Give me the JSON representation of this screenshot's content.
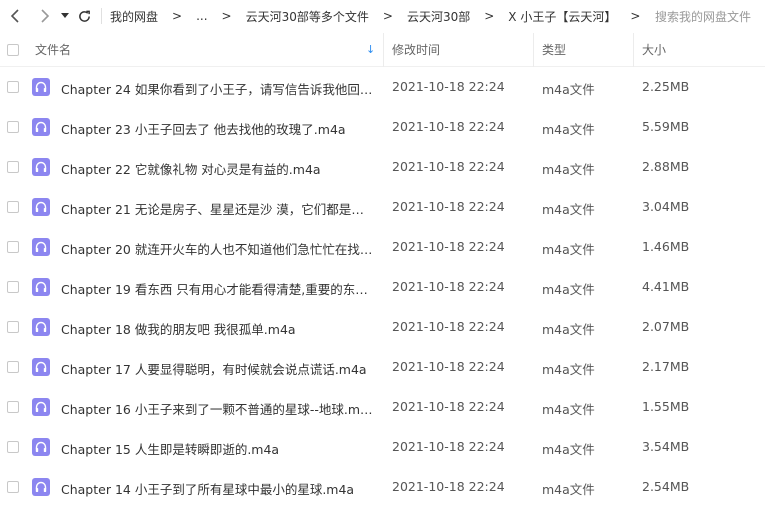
{
  "toolbar": {
    "breadcrumbs": [
      "我的网盘",
      "...",
      "云天河30部等多个文件",
      "云天河30部",
      "X 小王子【云天河】"
    ],
    "search_placeholder": "搜索我的网盘文件"
  },
  "columns": {
    "name": "文件名",
    "time": "修改时间",
    "type": "类型",
    "size": "大小"
  },
  "files": [
    {
      "name": "Chapter 24 如果你看到了小王子，请写信告诉我他回来...",
      "time": "2021-10-18 22:24",
      "type": "m4a文件",
      "size": "2.25MB"
    },
    {
      "name": "Chapter 23 小王子回去了 他去找他的玫瑰了.m4a",
      "time": "2021-10-18 22:24",
      "type": "m4a文件",
      "size": "5.59MB"
    },
    {
      "name": "Chapter 22 它就像礼物 对心灵是有益的.m4a",
      "time": "2021-10-18 22:24",
      "type": "m4a文件",
      "size": "2.88MB"
    },
    {
      "name": "Chapter 21 无论是房子、星星还是沙 漠，它们都是因为...",
      "time": "2021-10-18 22:24",
      "type": "m4a文件",
      "size": "3.04MB"
    },
    {
      "name": "Chapter 20 就连开火车的人也不知道他们急忙忙在找什...",
      "time": "2021-10-18 22:24",
      "type": "m4a文件",
      "size": "1.46MB"
    },
    {
      "name": "Chapter 19 看东西 只有用心才能看得清楚,重要的东西用...",
      "time": "2021-10-18 22:24",
      "type": "m4a文件",
      "size": "4.41MB"
    },
    {
      "name": "Chapter 18 做我的朋友吧 我很孤单.m4a",
      "time": "2021-10-18 22:24",
      "type": "m4a文件",
      "size": "2.07MB"
    },
    {
      "name": "Chapter 17 人要显得聪明，有时候就会说点谎话.m4a",
      "time": "2021-10-18 22:24",
      "type": "m4a文件",
      "size": "2.17MB"
    },
    {
      "name": "Chapter 16 小王子来到了一颗不普通的星球--地球.m4a",
      "time": "2021-10-18 22:24",
      "type": "m4a文件",
      "size": "1.55MB"
    },
    {
      "name": "Chapter 15 人生即是转瞬即逝的.m4a",
      "time": "2021-10-18 22:24",
      "type": "m4a文件",
      "size": "3.54MB"
    },
    {
      "name": "Chapter 14 小王子到了所有星球中最小的星球.m4a",
      "time": "2021-10-18 22:24",
      "type": "m4a文件",
      "size": "2.54MB"
    }
  ],
  "colors": {
    "file_icon": "#8c86f0",
    "sort_arrow": "#2e8ef0"
  }
}
